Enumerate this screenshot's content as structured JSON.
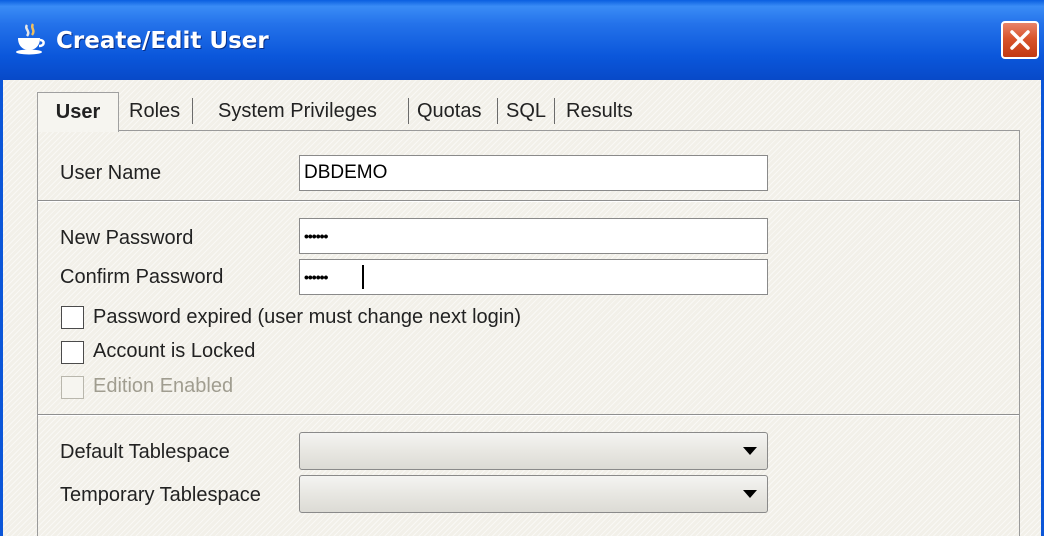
{
  "window": {
    "title": "Create/Edit User",
    "icon": "java-cup-icon",
    "close_icon": "close-icon",
    "title_bar_color": "#0b57db",
    "close_button_color": "#d9542c"
  },
  "tabs": [
    {
      "label": "User",
      "active": true
    },
    {
      "label": "Roles",
      "active": false
    },
    {
      "label": "System Privileges",
      "active": false
    },
    {
      "label": "Quotas",
      "active": false
    },
    {
      "label": "SQL",
      "active": false
    },
    {
      "label": "Results",
      "active": false
    }
  ],
  "form": {
    "user_name": {
      "label": "User Name",
      "value": "DBDEMO"
    },
    "new_password": {
      "label": "New Password",
      "value": "••••••"
    },
    "confirm_password": {
      "label": "Confirm Password",
      "value": "••••••"
    },
    "password_expired": {
      "label": "Password expired (user must change next login)",
      "checked": false,
      "enabled": true
    },
    "account_locked": {
      "label": "Account is Locked",
      "checked": false,
      "enabled": true
    },
    "edition_enabled": {
      "label": "Edition Enabled",
      "checked": false,
      "enabled": false
    },
    "default_tablespace": {
      "label": "Default Tablespace",
      "value": ""
    },
    "temporary_tablespace": {
      "label": "Temporary Tablespace",
      "value": ""
    }
  }
}
